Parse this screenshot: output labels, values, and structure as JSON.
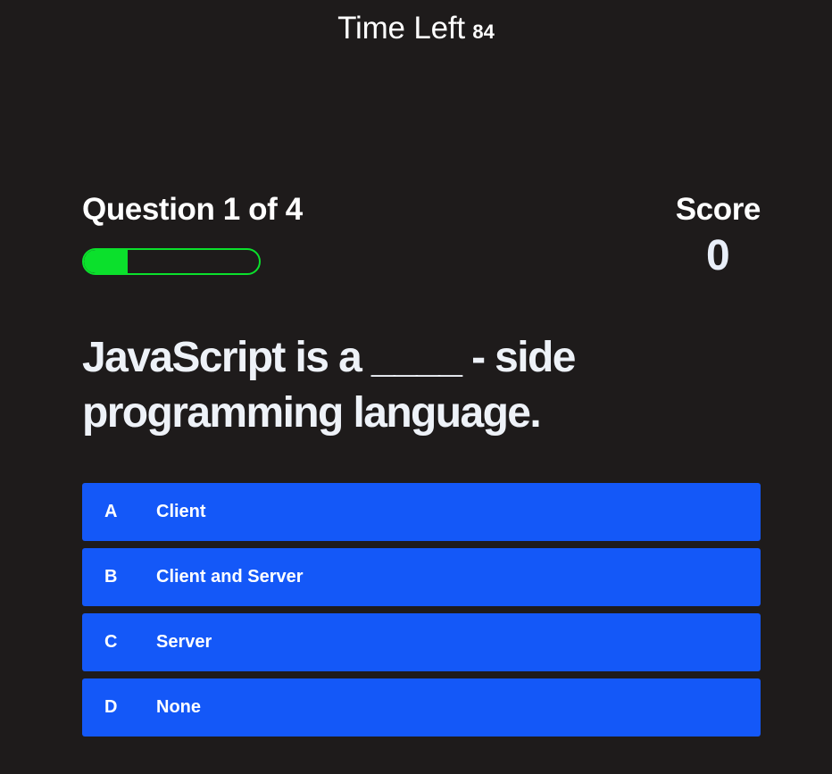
{
  "timer": {
    "label": "Time Left",
    "value": "84"
  },
  "hud": {
    "question_counter": "Question 1 of 4",
    "progress_fraction": 0.25,
    "progress_color": "#0be02c",
    "score_label": "Score",
    "score_value": "0"
  },
  "question": {
    "text": "JavaScript is a ____ - side programming language."
  },
  "choices": [
    {
      "prefix": "A",
      "text": "Client"
    },
    {
      "prefix": "B",
      "text": "Client and Server"
    },
    {
      "prefix": "C",
      "text": "Server"
    },
    {
      "prefix": "D",
      "text": "None"
    }
  ],
  "colors": {
    "background": "#1e1b1b",
    "choice_background": "#1458f8",
    "text": "#ffffff"
  }
}
